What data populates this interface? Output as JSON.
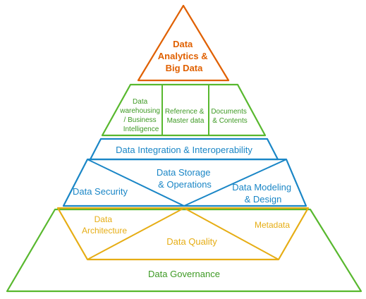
{
  "colors": {
    "orange": "#e06000",
    "green": "#58b82e",
    "blue": "#1a86c6",
    "gold": "#e6ad14",
    "text_green": "#3e9a24"
  },
  "apex": {
    "line1": "Data",
    "line2": "Analytics &",
    "line3": "Big Data"
  },
  "tier2": {
    "warehousing": {
      "line1": "Data",
      "line2": "warehousing",
      "line3": "/ Business",
      "line4": "Intelligence"
    },
    "reference": {
      "line1": "Reference &",
      "line2": "Master data"
    },
    "documents": {
      "line1": "Documents",
      "line2": "& Contents"
    }
  },
  "integration": "Data Integration & Interoperability",
  "tier4": {
    "storage": {
      "line1": "Data Storage",
      "line2": "& Operations"
    },
    "security": "Data Security",
    "modeling": {
      "line1": "Data Modeling",
      "line2": "& Design"
    }
  },
  "tier5": {
    "architecture": {
      "line1": "Data",
      "line2": "Architecture"
    },
    "quality": "Data Quality",
    "metadata": "Metadata"
  },
  "governance": "Data Governance"
}
